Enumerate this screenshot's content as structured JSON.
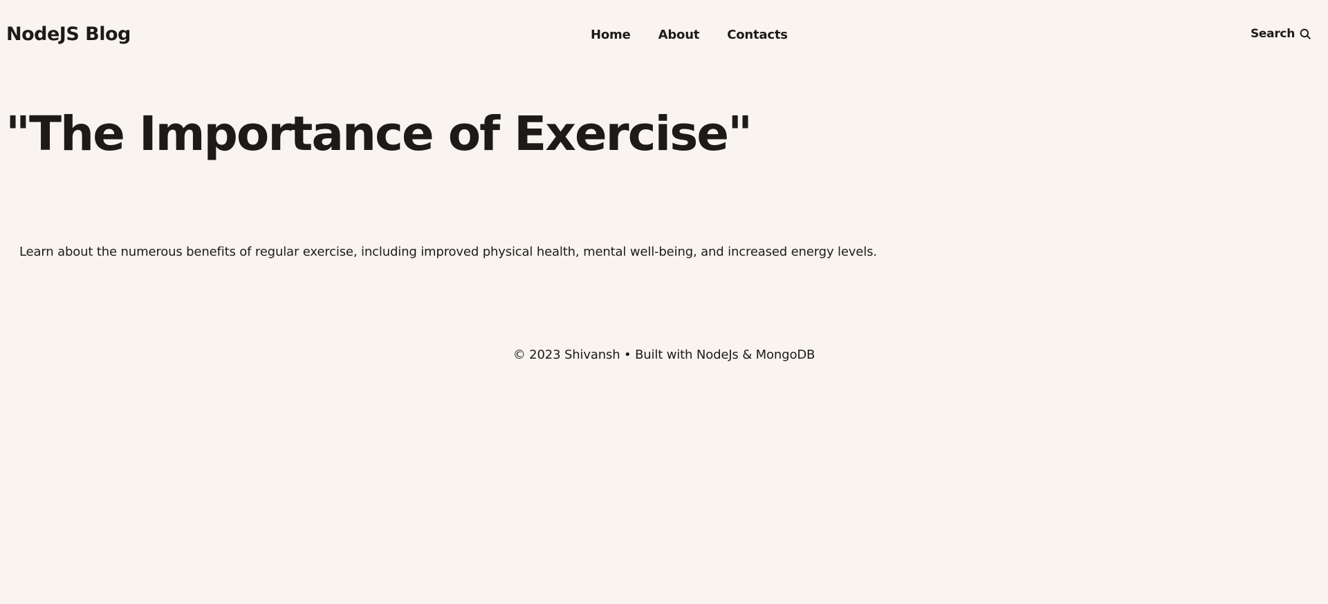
{
  "header": {
    "logo": "NodeJS Blog",
    "nav": [
      {
        "label": "Home"
      },
      {
        "label": "About"
      },
      {
        "label": "Contacts"
      }
    ],
    "search": {
      "label": "Search",
      "icon": "search-icon"
    }
  },
  "article": {
    "title": "\"The Importance of Exercise\"",
    "body": "Learn about the numerous benefits of regular exercise, including improved physical health, mental well-being, and increased energy levels."
  },
  "footer": {
    "text": "© 2023 Shivansh • Built with NodeJs & MongoDB"
  },
  "colors": {
    "background": "#f9f4ef",
    "text": "#1c1b1a"
  }
}
